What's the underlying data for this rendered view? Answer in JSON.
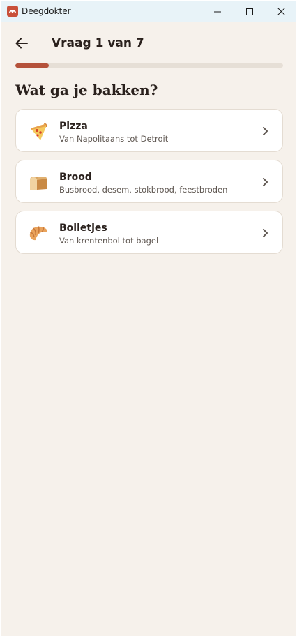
{
  "window": {
    "title": "Deegdokter"
  },
  "header": {
    "back_icon": "arrow-left-icon",
    "title": "Vraag 1 van 7"
  },
  "progress": {
    "current": 1,
    "total": 7,
    "fraction": 0.125,
    "color": "#b5523b",
    "track_color": "#e6dfd6"
  },
  "question": "Wat ga je bakken?",
  "options": [
    {
      "title": "Pizza",
      "subtitle": "Van Napolitaans tot Detroit",
      "icon": "pizza-icon"
    },
    {
      "title": "Brood",
      "subtitle": "Busbrood, desem, stokbrood, feestbroden",
      "icon": "bread-icon"
    },
    {
      "title": "Bolletjes",
      "subtitle": "Van krentenbol tot bagel",
      "icon": "croissant-icon"
    }
  ],
  "colors": {
    "background": "#f6f1eb",
    "accent": "#b5523b",
    "text": "#2a211d"
  }
}
